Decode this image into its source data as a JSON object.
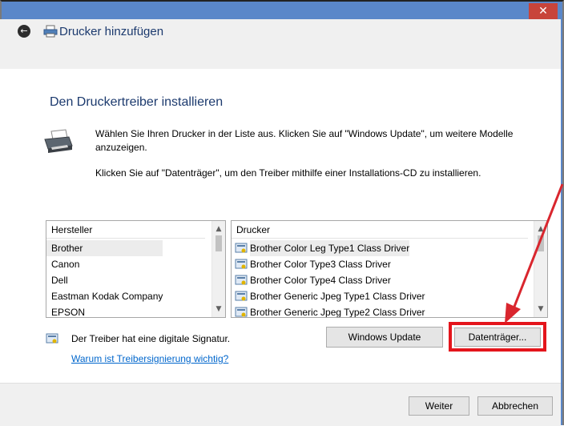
{
  "window": {
    "title": "Drucker hinzufügen",
    "close_glyph": "✕",
    "back_glyph": "←"
  },
  "main": {
    "heading": "Den Druckertreiber installieren",
    "description_line1": "Wählen Sie Ihren Drucker in der Liste aus. Klicken Sie auf \"Windows Update\", um weitere Modelle anzuzeigen.",
    "description_line2": "Klicken Sie auf \"Datenträger\", um den Treiber mithilfe einer Installations-CD zu installieren."
  },
  "manufacturers": {
    "header": "Hersteller",
    "items": [
      "Brother",
      "Canon",
      "Dell",
      "Eastman Kodak Company",
      "EPSON"
    ],
    "selected": "Brother"
  },
  "drivers": {
    "header": "Drucker",
    "items": [
      "Brother Color Leg Type1 Class Driver",
      "Brother Color Type3 Class Driver",
      "Brother Color Type4 Class Driver",
      "Brother Generic Jpeg Type1 Class Driver",
      "Brother Generic Jpeg Type2 Class Driver"
    ],
    "selected": "Brother Color Leg Type1 Class Driver"
  },
  "signature": {
    "text": "Der Treiber hat eine digitale Signatur.",
    "link": "Warum ist Treibersignierung wichtig?"
  },
  "buttons": {
    "windows_update": "Windows Update",
    "datentraeger": "Datenträger...",
    "weiter": "Weiter",
    "abbrechen": "Abbrechen"
  },
  "icons": {
    "back": "back-arrow-icon",
    "title": "printer-icon",
    "header": "printer-install-icon",
    "driver": "signed-driver-icon"
  },
  "colors": {
    "accent": "#5a87c9",
    "close": "#c8443a",
    "highlight": "#e4151c",
    "link": "#0066cc",
    "heading": "#1c3a6e"
  }
}
